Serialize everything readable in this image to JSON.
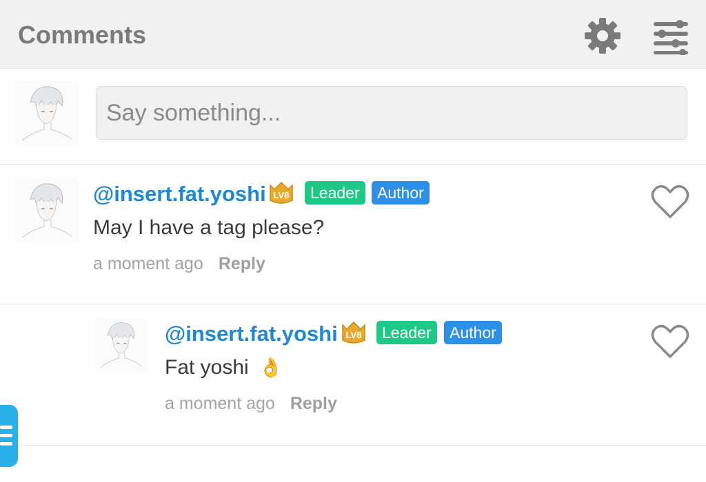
{
  "header": {
    "title": "Comments",
    "settings_icon": "gear-icon",
    "filter_icon": "sliders-icon"
  },
  "compose": {
    "placeholder": "Say something..."
  },
  "comments": [
    {
      "username": "@insert.fat.yoshi",
      "level": "LV8",
      "badges": [
        "Leader",
        "Author"
      ],
      "text": "May I have a tag please?",
      "time": "a moment ago",
      "reply_label": "Reply"
    },
    {
      "username": "@insert.fat.yoshi",
      "level": "LV8",
      "badges": [
        "Leader",
        "Author"
      ],
      "text": "Fat yoshi",
      "emoji": "👌",
      "time": "a moment ago",
      "reply_label": "Reply"
    }
  ],
  "colors": {
    "username": "#1e88d8",
    "leader": "#1cc985",
    "author": "#2d8fe6",
    "header_bg": "#f1f1f1"
  }
}
